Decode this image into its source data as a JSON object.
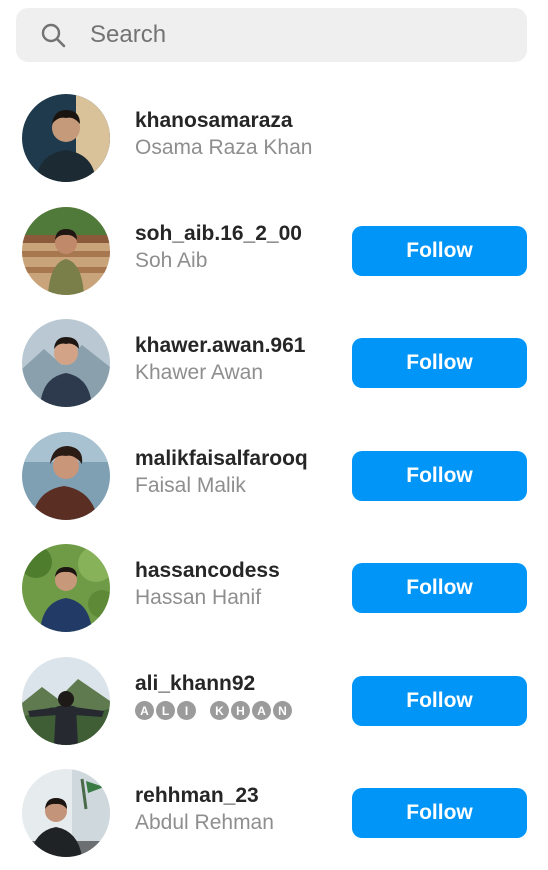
{
  "search": {
    "placeholder": "Search",
    "icon": "search-icon"
  },
  "colors": {
    "follow_button_bg": "#0095f6",
    "search_bg": "#efefef",
    "secondary_text": "#8e8e8e"
  },
  "users": [
    {
      "username": "khanosamaraza",
      "full_name": "Osama Raza Khan",
      "button": ""
    },
    {
      "username": "soh_aib.16_2_00",
      "full_name": "Soh Aib",
      "button": "Follow"
    },
    {
      "username": "khawer.awan.961",
      "full_name": "Khawer Awan",
      "button": "Follow"
    },
    {
      "username": "malikfaisalfarooq",
      "full_name": "Faisal Malik",
      "button": "Follow"
    },
    {
      "username": "hassancodess",
      "full_name": "Hassan Hanif",
      "button": "Follow"
    },
    {
      "username": "ali_khann92",
      "full_name": "🅐🅛🅘 🅚🅗🅐🅝",
      "button": "Follow"
    },
    {
      "username": "rehhman_23",
      "full_name": "Abdul Rehman",
      "button": "Follow"
    }
  ],
  "circled_name_letters": [
    "A",
    "L",
    "I",
    " ",
    "K",
    "H",
    "A",
    "N"
  ]
}
